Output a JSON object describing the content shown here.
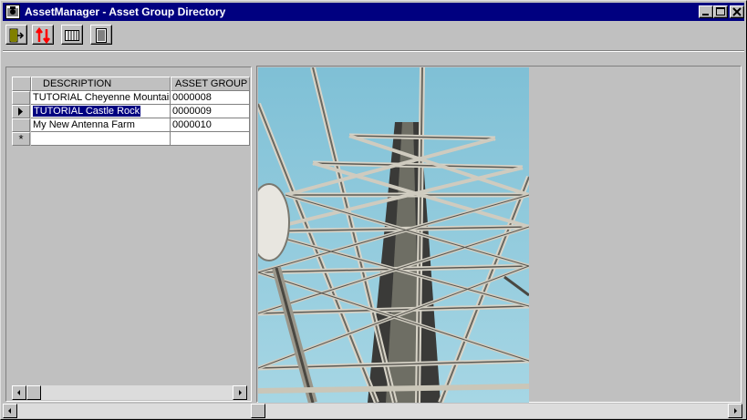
{
  "window": {
    "title": "AssetManager - Asset Group Directory",
    "buttons": [
      "minimize",
      "maximize",
      "close"
    ]
  },
  "toolbar": {
    "tools": [
      {
        "icon": "exit-door-icon"
      },
      {
        "icon": "sort-arrows-icon"
      },
      {
        "icon": "columns-icon"
      },
      {
        "icon": "report-icon"
      }
    ]
  },
  "grid": {
    "columns": [
      "DESCRIPTION",
      "ASSET GROUP"
    ],
    "rows": [
      {
        "description": "TUTORIAL Cheyenne Mountain",
        "asset_group": "0000008"
      },
      {
        "description": "TUTORIAL Castle Rock",
        "asset_group": "0000009"
      },
      {
        "description": "My New Antenna Farm",
        "asset_group": "0000010"
      }
    ],
    "current_row_index": 1,
    "new_row_marker": "*"
  },
  "image": {
    "subject": "antenna tower photo"
  },
  "colors": {
    "titlebar": "#000080",
    "selection": "#000080",
    "face": "#c0c0c0",
    "sky": "#8ec6d8"
  }
}
